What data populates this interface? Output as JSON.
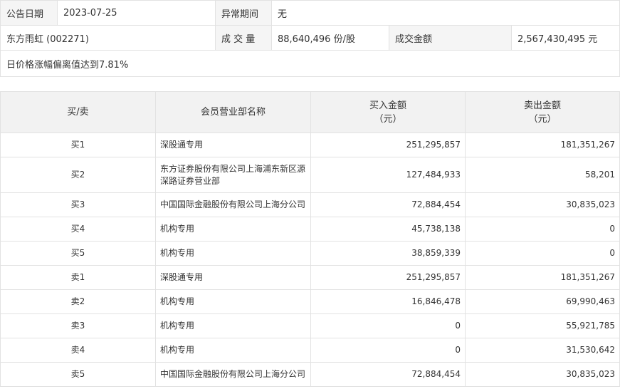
{
  "info": {
    "announce_date_label": "公告日期",
    "announce_date_value": "2023-07-25",
    "abnormal_period_label": "异常期间",
    "abnormal_period_value": "无",
    "stock_name": "东方雨虹 (002271)",
    "volume_label": "成 交 量",
    "volume_value": "88,640,496 份/股",
    "amount_label": "成交金额",
    "amount_value": "2,567,430,495 元",
    "reason": "日价格涨幅偏离值达到7.81%"
  },
  "table": {
    "headers": {
      "side": "买/卖",
      "dept": "会员营业部名称",
      "buy_line1": "买入金额",
      "buy_line2": "（元）",
      "sell_line1": "卖出金额",
      "sell_line2": "（元）"
    },
    "rows": [
      {
        "side": "买1",
        "dept": "深股通专用",
        "buy": "251,295,857",
        "sell": "181,351,267"
      },
      {
        "side": "买2",
        "dept": "东方证券股份有限公司上海浦东新区源深路证券营业部",
        "buy": "127,484,933",
        "sell": "58,201"
      },
      {
        "side": "买3",
        "dept": "中国国际金融股份有限公司上海分公司",
        "buy": "72,884,454",
        "sell": "30,835,023"
      },
      {
        "side": "买4",
        "dept": "机构专用",
        "buy": "45,738,138",
        "sell": "0"
      },
      {
        "side": "买5",
        "dept": "机构专用",
        "buy": "38,859,339",
        "sell": "0"
      },
      {
        "side": "卖1",
        "dept": "深股通专用",
        "buy": "251,295,857",
        "sell": "181,351,267"
      },
      {
        "side": "卖2",
        "dept": "机构专用",
        "buy": "16,846,478",
        "sell": "69,990,463"
      },
      {
        "side": "卖3",
        "dept": "机构专用",
        "buy": "0",
        "sell": "55,921,785"
      },
      {
        "side": "卖4",
        "dept": "机构专用",
        "buy": "0",
        "sell": "31,530,642"
      },
      {
        "side": "卖5",
        "dept": "中国国际金融股份有限公司上海分公司",
        "buy": "72,884,454",
        "sell": "30,835,023"
      }
    ]
  }
}
